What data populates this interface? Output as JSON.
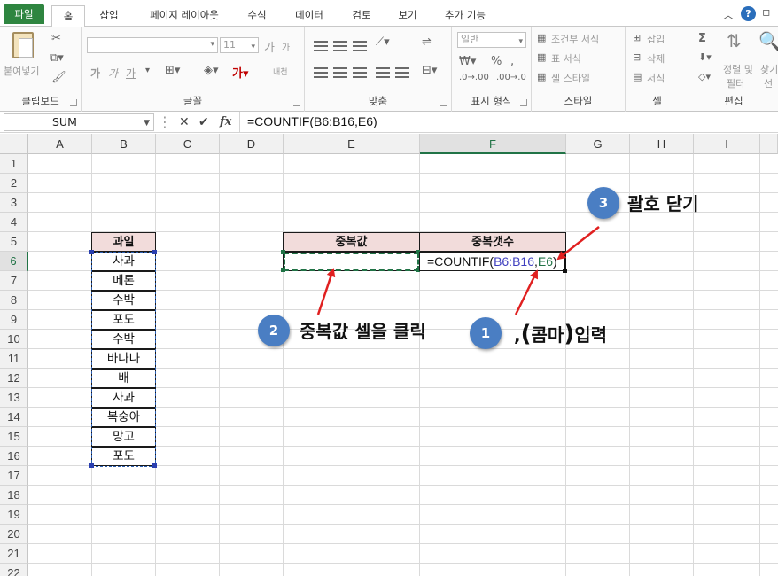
{
  "ribbon_tabs": [
    "파일",
    "홈",
    "삽입",
    "페이지 레이아웃",
    "수식",
    "데이터",
    "검토",
    "보기",
    "추가 기능"
  ],
  "ribbon": {
    "clipboard": {
      "paste": "붙여넣기",
      "label": "클립보드"
    },
    "font": {
      "size": "11",
      "label": "글꼴",
      "bold": "가",
      "italic": "가",
      "underline": "가",
      "grow": "가",
      "shrink": "가",
      "phonetic": "내천"
    },
    "alignment": {
      "label": "맞춤"
    },
    "number": {
      "format": "일반",
      "label": "표시 형식"
    },
    "styles": {
      "conditional": "조건부 서식",
      "table": "표 서식",
      "cell_style": "셀 스타일",
      "label": "스타일"
    },
    "cells": {
      "insert": "삽입",
      "delete": "삭제",
      "format": "서식",
      "label": "셀"
    },
    "editing": {
      "sort_filter": "정렬 및",
      "sort_filter2": "필터",
      "find": "찾기",
      "find2": "선",
      "label": "편집",
      "sigma": "Σ"
    }
  },
  "formula_bar": {
    "name_box": "SUM",
    "formula": "=COUNTIF(B6:B16,E6)",
    "fx": "fx"
  },
  "columns": [
    "A",
    "B",
    "C",
    "D",
    "E",
    "F",
    "G",
    "H",
    "I"
  ],
  "rows": [
    "1",
    "2",
    "3",
    "4",
    "5",
    "6",
    "7",
    "8",
    "9",
    "10",
    "11",
    "12",
    "13",
    "14",
    "15",
    "16",
    "17",
    "18",
    "19",
    "20",
    "21",
    "22"
  ],
  "sheet": {
    "fruit_header": "과일",
    "fruits": [
      "사과",
      "메론",
      "수박",
      "포도",
      "수박",
      "바나나",
      "배",
      "사과",
      "복숭아",
      "망고",
      "포도"
    ],
    "dup_value_header": "중복값",
    "dup_count_header": "중복갯수",
    "formula_prefix": "=COUNTIF(",
    "formula_range": "B6:B16",
    "formula_comma": ",",
    "formula_ref": "E6",
    "formula_close": ")"
  },
  "annotations": {
    "step1": {
      "num": "1",
      "text_comma": ",",
      "paren_open": "(",
      "text_middle": "콤마",
      "paren_close": ")",
      "text_end": "입력"
    },
    "step2": {
      "num": "2",
      "text": "중복값 셀을 클릭"
    },
    "step3": {
      "num": "3",
      "text": "괄호 닫기"
    }
  },
  "colors": {
    "accent_green": "#217346",
    "header_fill": "#f2dcdb",
    "badge": "#4a7ec3",
    "arrow": "#e02020"
  }
}
